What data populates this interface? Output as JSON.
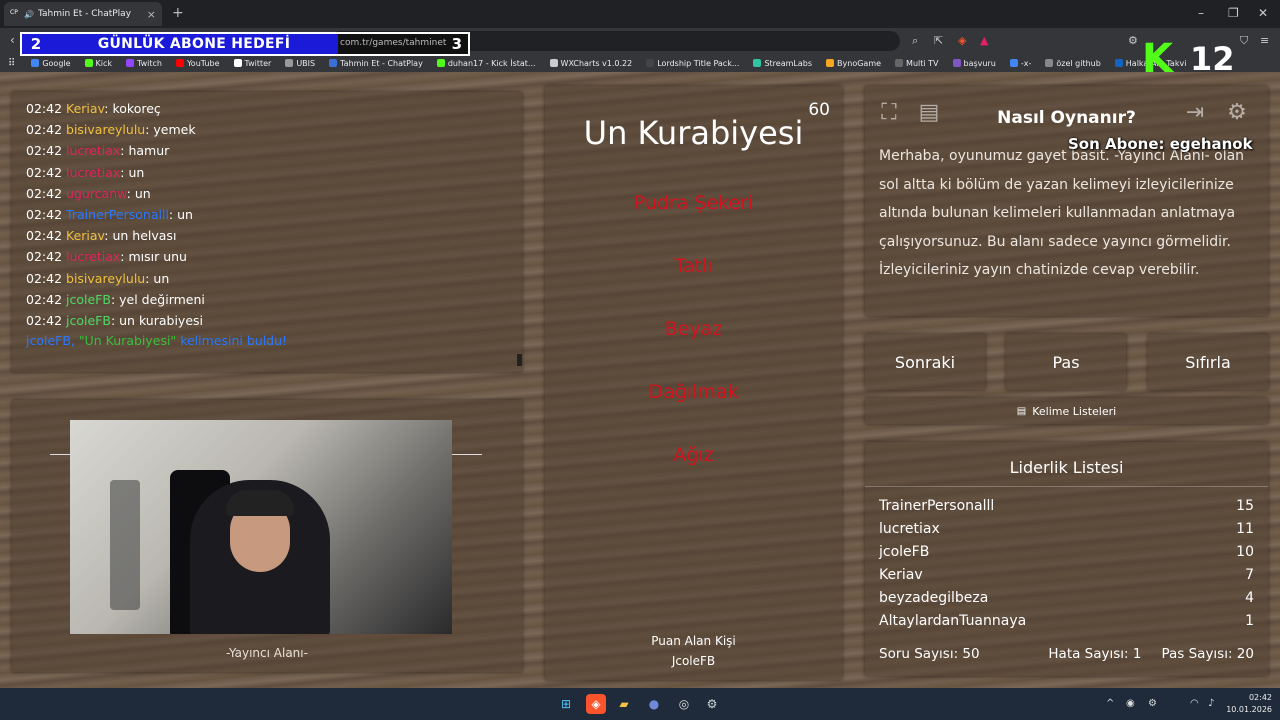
{
  "browser": {
    "tab_title": "Tahmin Et - ChatPlay",
    "tab_favicon": "CP",
    "url_fragment": "com.tr/games/tahminet",
    "bookmarks": [
      {
        "label": "Google",
        "color": "#4285f4"
      },
      {
        "label": "Kick",
        "color": "#53fc18"
      },
      {
        "label": "Twitch",
        "color": "#9146ff"
      },
      {
        "label": "YouTube",
        "color": "#ff0000"
      },
      {
        "label": "Twitter",
        "color": "#ffffff"
      },
      {
        "label": "UBIS",
        "color": "#999999"
      },
      {
        "label": "Tahmin Et - ChatPlay",
        "color": "#3b6fd8"
      },
      {
        "label": "duhan17 - Kick İstat...",
        "color": "#53fc18"
      },
      {
        "label": "WXCharts v1.0.22",
        "color": "#cccccc"
      },
      {
        "label": "Lordship Title Pack...",
        "color": "#444444"
      },
      {
        "label": "StreamLabs",
        "color": "#31c3a2"
      },
      {
        "label": "BynoGame",
        "color": "#f5a623"
      },
      {
        "label": "Multi TV",
        "color": "#666666"
      },
      {
        "label": "başvuru",
        "color": "#7e57c2"
      },
      {
        "label": "-x-",
        "color": "#4285f4"
      },
      {
        "label": "özel github",
        "color": "#888888"
      },
      {
        "label": "Halka Arz Takvi",
        "color": "#1565c0"
      }
    ]
  },
  "overlay": {
    "goal_current": "2",
    "goal_label": "GÜNLÜK ABONE HEDEFİ",
    "goal_target": "3",
    "kick_logo": "K",
    "kick_count": "12",
    "last_sub": "Son Abone: egehanok"
  },
  "chat": {
    "lines": [
      {
        "time": "02:42",
        "user": "Keriav",
        "color": "#f0c040",
        "msg": ": kokoreç"
      },
      {
        "time": "02:42",
        "user": "bisivareylulu",
        "color": "#f0c040",
        "msg": ": yemek"
      },
      {
        "time": "02:42",
        "user": "lucretiax",
        "color": "#e0245e",
        "msg": ": hamur"
      },
      {
        "time": "02:42",
        "user": "lucretiax",
        "color": "#e0245e",
        "msg": ": un"
      },
      {
        "time": "02:42",
        "user": "ugurcanw",
        "color": "#e0245e",
        "msg": ": un"
      },
      {
        "time": "02:42",
        "user": "TrainerPersonalll",
        "color": "#2979ff",
        "msg": ": un"
      },
      {
        "time": "02:42",
        "user": "Keriav",
        "color": "#f0c040",
        "msg": ": un helvası"
      },
      {
        "time": "02:42",
        "user": "lucretiax",
        "color": "#e0245e",
        "msg": ": mısır unu"
      },
      {
        "time": "02:42",
        "user": "bisivareylulu",
        "color": "#f0c040",
        "msg": ": un"
      },
      {
        "time": "02:42",
        "user": "jcoleFB",
        "color": "#4cd964",
        "msg": ": yel değirmeni"
      },
      {
        "time": "02:42",
        "user": "jcoleFB",
        "color": "#4cd964",
        "msg": ": un kurabiyesi"
      }
    ],
    "found_user": "jcoleFB,",
    "found_word": "\"Un Kurabiyesi\"",
    "found_suffix": "kelimesini buldu!"
  },
  "streamer": {
    "area_label": "-Yayıncı Alanı-"
  },
  "game": {
    "timer": "60",
    "word": "Un Kurabiyesi",
    "forbidden": [
      "Pudra Şekeri",
      "Tatlı",
      "Beyaz",
      "Dağılmak",
      "Ağız"
    ],
    "winner_label": "Puan Alan Kişi",
    "winner_name": "JcoleFB"
  },
  "help": {
    "title": "Nasıl Oynanır?",
    "text": "Merhaba, oyunumuz gayet basit. -Yayıncı Alanı- olan sol altta ki bölüm de yazan kelimeyi izleyicilerinize altında bulunan kelimeleri kullanmadan anlatmaya çalışıyorsunuz. Bu alanı sadece yayıncı görmelidir. İzleyicileriniz yayın chatinizde cevap verebilir.",
    "icons": [
      "fullscreen-icon",
      "notes-icon",
      "exit-icon",
      "settings-icon"
    ]
  },
  "controls": {
    "next": "Sonraki",
    "pass": "Pas",
    "reset": "Sıfırla",
    "word_lists": "Kelime Listeleri"
  },
  "leaderboard": {
    "title": "Liderlik Listesi",
    "rows": [
      {
        "name": "TrainerPersonalll",
        "score": "15"
      },
      {
        "name": "lucretiax",
        "score": "11"
      },
      {
        "name": "jcoleFB",
        "score": "10"
      },
      {
        "name": "Keriav",
        "score": "7"
      },
      {
        "name": "beyzadegilbeza",
        "score": "4"
      },
      {
        "name": "AltaylardanTuannaya",
        "score": "1"
      }
    ],
    "questions": "Soru Sayısı: 50",
    "errors": "Hata Sayısı: 1",
    "passes": "Pas Sayısı: 20"
  },
  "taskbar": {
    "clock_time": "02:42",
    "clock_date": "10.01.2026"
  }
}
